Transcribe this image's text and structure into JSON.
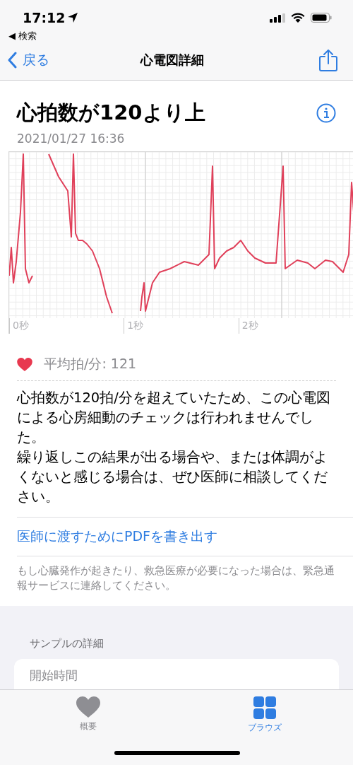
{
  "status_bar": {
    "time": "17:12",
    "back_app": "◀ 検索"
  },
  "nav": {
    "back": "戻る",
    "title": "心電図詳細"
  },
  "header": {
    "title": "心拍数が120より上",
    "date": "2021/01/27 16:36"
  },
  "ecg": {
    "time_labels": [
      "0秒",
      "1秒",
      "2秒"
    ]
  },
  "average": {
    "label": "平均拍/分: 121"
  },
  "message": [
    "心拍数が120拍/分を超えていたため、この心電図による心房細動のチェックは行われませんでした。",
    "繰り返しこの結果が出る場合や、または体調がよくないと感じる場合は、ぜひ医師に相談してください。"
  ],
  "export_link": "医師に渡すためにPDFを書き出す",
  "emergency_note": "もし心臓発作が起きたり、救急医療が必要になった場合は、緊急通報サービスに連絡してください。",
  "sample_details": {
    "heading": "サンプルの詳細",
    "rows": [
      "開始時間"
    ]
  },
  "tab_bar": [
    {
      "label": "概要",
      "kind": "heart",
      "selected": false
    },
    {
      "label": "ブラウズ",
      "kind": "grid",
      "selected": true
    }
  ]
}
